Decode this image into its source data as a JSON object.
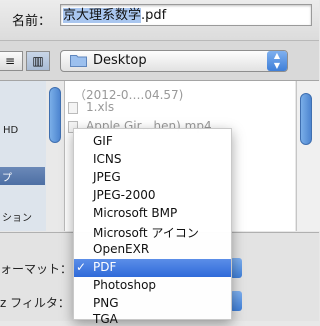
{
  "header": {
    "name_label": "名前：",
    "filename_selected": "京大理系数学",
    "filename_ext": ".pdf"
  },
  "toolbar": {
    "view_list_icon": "≡",
    "view_column_icon": "▥",
    "location": "Desktop",
    "location_arrows": "▲\n▼"
  },
  "sidebar": {
    "items": [
      "HD",
      "プ",
      "ション"
    ]
  },
  "files": [
    "（2012-0….04.57)",
    "1.xls",
    "Apple Gir…hen) mp4"
  ],
  "options": {
    "format_label": "ォーマット：",
    "filter_label": "z フィルタ："
  },
  "menu": {
    "items": [
      "GIF",
      "ICNS",
      "JPEG",
      "JPEG-2000",
      "Microsoft BMP",
      "Microsoft アイコン",
      "OpenEXR",
      "PDF",
      "Photoshop",
      "PNG",
      "TGA"
    ],
    "selected": "PDF",
    "check": "✓"
  },
  "colors": {
    "accent": "#3f7fd8",
    "selection": "#2f6ad9",
    "sidebar_selection": "#4d6fa4"
  }
}
